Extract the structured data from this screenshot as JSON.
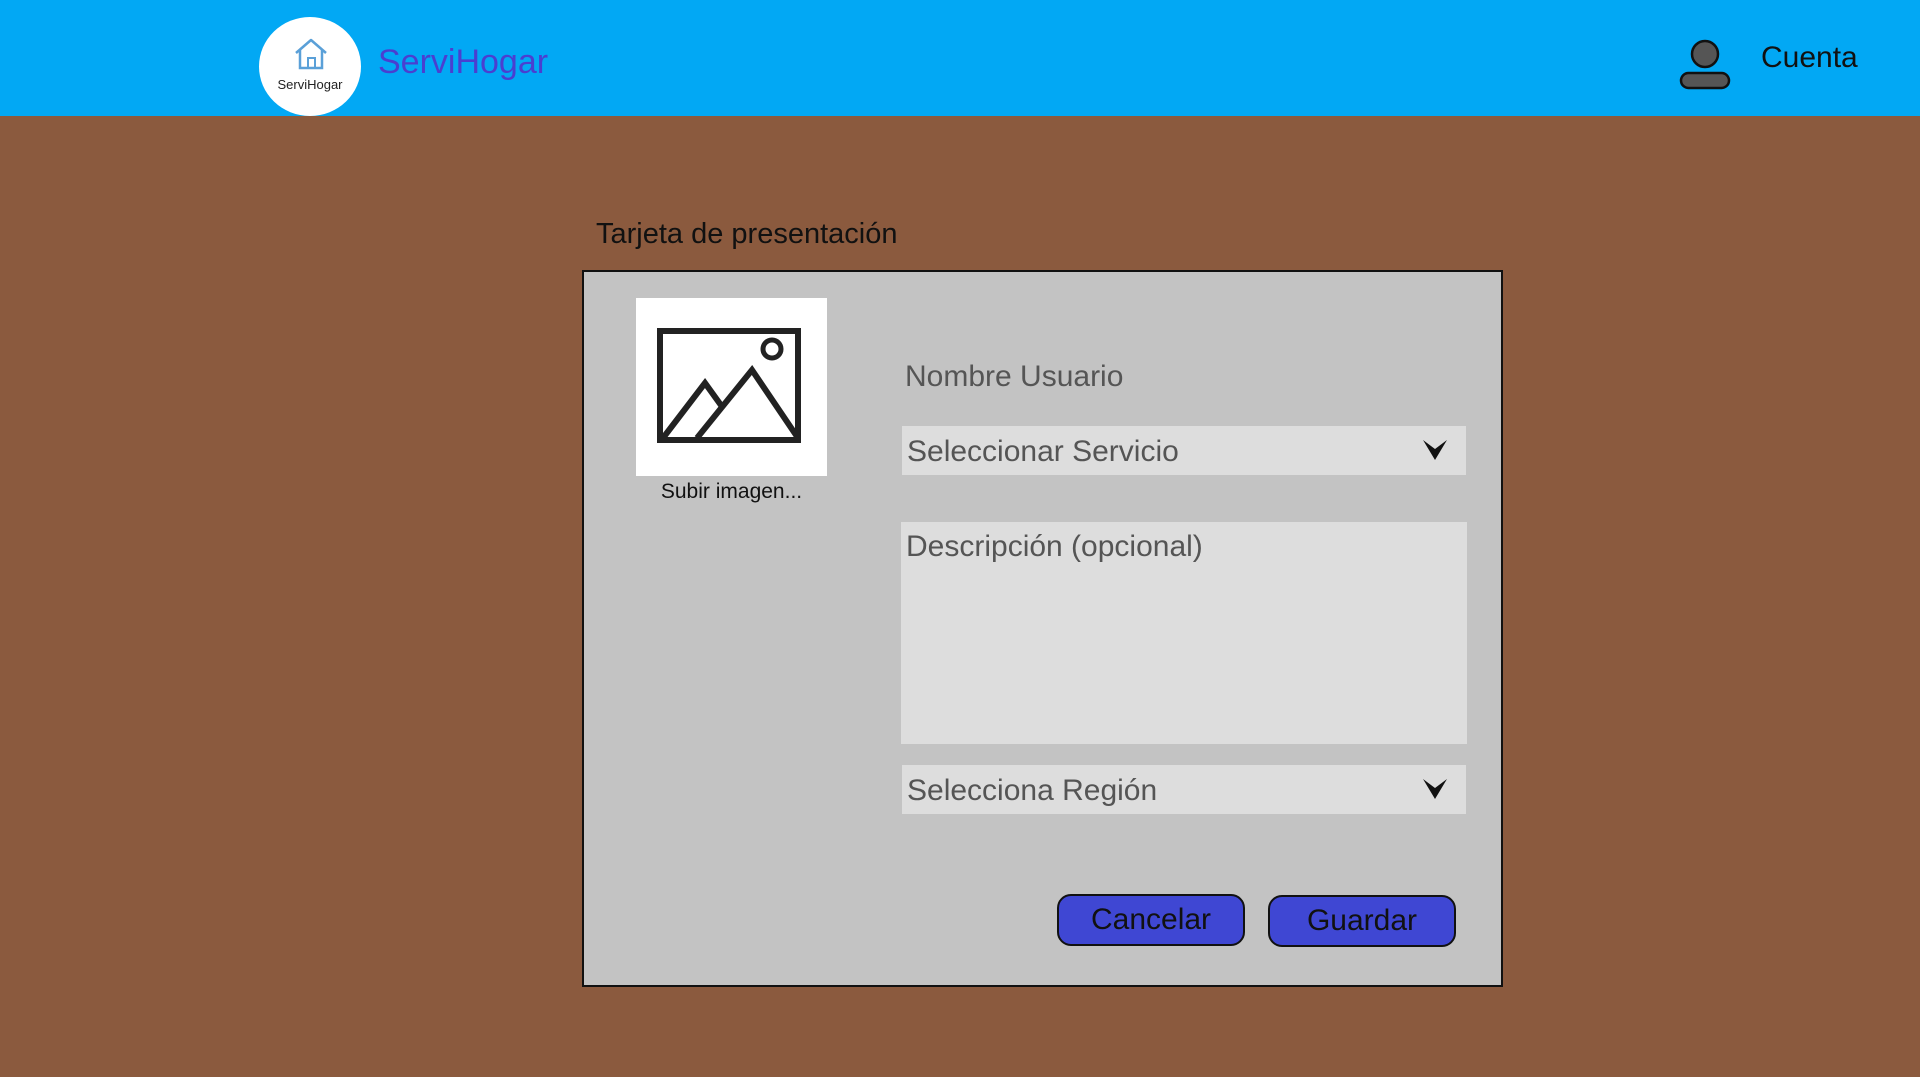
{
  "header": {
    "logo_text": "ServiHogar",
    "brand": "ServiHogar",
    "account_label": "Cuenta",
    "background": "#02A8F4",
    "brand_color": "#4A3FD0"
  },
  "form": {
    "section_title": "Tarjeta de presentación",
    "upload_label": "Subir imagen...",
    "username": "Nombre Usuario",
    "service_select": "Seleccionar Servicio",
    "description_placeholder": "Descripción (opcional)",
    "region_select": "Selecciona Región",
    "cancel_label": "Cancelar",
    "save_label": "Guardar",
    "button_color": "#3F47D3",
    "card_background": "#C3C3C3"
  },
  "icons": {
    "logo": "house-icon",
    "account": "user-icon",
    "image": "image-placeholder-icon",
    "dropdown": "chevron-down-icon"
  },
  "page_background": "#8B5A3E"
}
